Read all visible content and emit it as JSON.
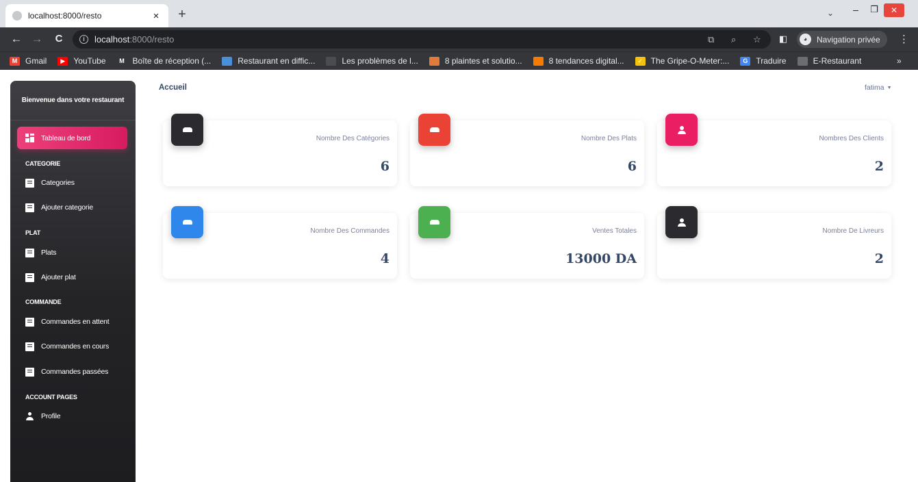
{
  "browser": {
    "tab_title": "localhost:8000/resto",
    "tab_close": "×",
    "new_tab": "+",
    "tab_dropdown": "⌄",
    "window_minimize": "–",
    "window_maximize": "❐",
    "window_close": "✕",
    "back": "←",
    "forward": "→",
    "reload": "C",
    "url_host": "localhost",
    "url_rest": ":8000/resto",
    "incognito_label": "Navigation privée",
    "more_bookmarks": "»",
    "bookmarks": [
      {
        "label": "Gmail",
        "color": "#ea4335",
        "glyph": "M"
      },
      {
        "label": "YouTube",
        "color": "#ff0000",
        "glyph": "▶"
      },
      {
        "label": "Boîte de réception (...",
        "color": "#35363a",
        "glyph": "M"
      },
      {
        "label": "Restaurant en diffic...",
        "color": "#4a90d9",
        "glyph": ""
      },
      {
        "label": "Les problèmes de l...",
        "color": "#4a4c50",
        "glyph": ""
      },
      {
        "label": "8 plaintes et solutio...",
        "color": "#e07b39",
        "glyph": ""
      },
      {
        "label": "8 tendances digital...",
        "color": "#f57c00",
        "glyph": ""
      },
      {
        "label": "The Gripe-O-Meter:...",
        "color": "#f4c20d",
        "glyph": "✓"
      },
      {
        "label": "Traduire",
        "color": "#4285f4",
        "glyph": "G"
      },
      {
        "label": "E-Restaurant",
        "color": "#6b6d70",
        "glyph": ""
      }
    ]
  },
  "sidebar": {
    "brand": "Bienvenue dans votre restaurant",
    "active": "Tableau de bord",
    "sections": {
      "categorie": "CATEGORIE",
      "plat": "PLAT",
      "commande": "COMMANDE",
      "account": "ACCOUNT PAGES"
    },
    "items": {
      "categories": "Categories",
      "ajouter_categorie": "Ajouter categorie",
      "plats": "Plats",
      "ajouter_plat": "Ajouter plat",
      "commandes_attente": "Commandes en attent",
      "commandes_cours": "Commandes en cours",
      "commandes_passees": "Commandes passées",
      "profile": "Profile"
    }
  },
  "header": {
    "breadcrumb": "Accueil",
    "user": "fatima"
  },
  "stats": [
    {
      "label": "Nombre Des Catégories",
      "value": "6",
      "color": "#2b2b2f",
      "icon": "tray-icon"
    },
    {
      "label": "Nombre Des Plats",
      "value": "6",
      "color": "#ea4335",
      "icon": "tray-icon"
    },
    {
      "label": "Nombres Des Clients",
      "value": "2",
      "color": "#e91e63",
      "icon": "person-icon"
    },
    {
      "label": "Nombre Des Commandes",
      "value": "4",
      "color": "#2f86eb",
      "icon": "tray-icon"
    },
    {
      "label": "Ventes Totales",
      "value": "13000 DA",
      "color": "#4caf50",
      "icon": "tray-icon"
    },
    {
      "label": "Nombre De Livreurs",
      "value": "2",
      "color": "#2b2b2f",
      "icon": "person-icon"
    }
  ]
}
